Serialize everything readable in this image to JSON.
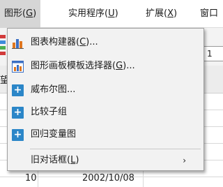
{
  "menubar": {
    "items": [
      {
        "label": "图形(",
        "key": "G",
        "suffix": ")"
      },
      {
        "label": "实用程序(",
        "key": "U",
        "suffix": ")"
      },
      {
        "label": "扩展(",
        "key": "X",
        "suffix": ")"
      },
      {
        "label": "窗口"
      }
    ]
  },
  "toolbar": {
    "field_value": "1"
  },
  "grid": {
    "header_fragment": "望",
    "cells": {
      "row_num": "10",
      "date": "2002/10/08"
    }
  },
  "graphs_menu": {
    "items": [
      {
        "label": "图表构建器(",
        "key": "C",
        "suffix": ")...",
        "icon": "chart-builder-icon"
      },
      {
        "label": "图形画板模板选择器(",
        "key": "G",
        "suffix": ")...",
        "icon": "graphboard-icon"
      },
      {
        "label": "威布尔图...",
        "icon": "plus-icon"
      },
      {
        "label": "比较子组",
        "icon": "plus-icon"
      },
      {
        "label": "回归变量图",
        "icon": "plus-icon"
      },
      {
        "label": "旧对话框(",
        "key": "L",
        "suffix": ")",
        "submenu_arrow": "›"
      }
    ]
  },
  "colors": {
    "active_menu_bg": "#d6d6d6",
    "icon_blue": "#2b86c8",
    "menu_bg": "#f2f2f2"
  }
}
